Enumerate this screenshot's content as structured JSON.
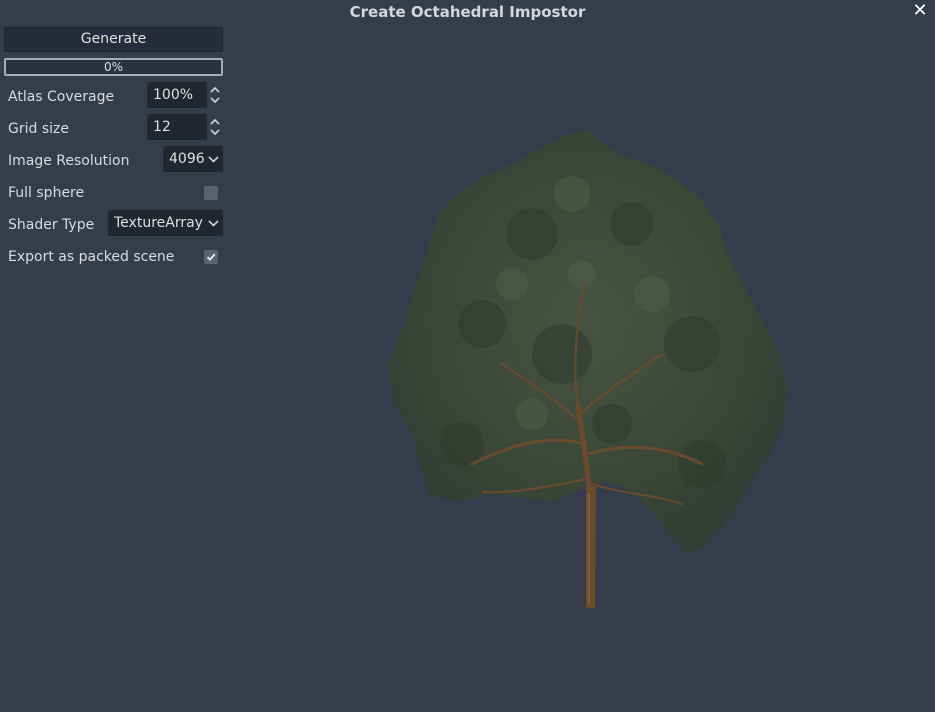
{
  "window": {
    "title": "Create Octahedral Impostor",
    "close_glyph": "✕"
  },
  "sidebar": {
    "generate_label": "Generate",
    "progress": {
      "value": 0,
      "text": "0%"
    },
    "atlas_coverage": {
      "label": "Atlas Coverage",
      "value": "100%"
    },
    "grid_size": {
      "label": "Grid size",
      "value": "12"
    },
    "image_resolution": {
      "label": "Image Resolution",
      "value": "4096"
    },
    "full_sphere": {
      "label": "Full sphere",
      "checked": false
    },
    "shader_type": {
      "label": "Shader Type",
      "value": "TextureArray"
    },
    "export_packed": {
      "label": "Export as packed scene",
      "checked": true
    }
  },
  "colors": {
    "background": "#363d4a",
    "field": "#21262f",
    "button": "#262c3b",
    "progress_border": "#a6abb4",
    "foliage": "#3a4a37",
    "trunk": "#6b4a2e"
  },
  "icons": {
    "close": "close-icon",
    "spin": "up-down-arrows-icon",
    "dropdown": "chevron-down-icon",
    "check": "checkmark-icon"
  },
  "viewport": {
    "subject": "tree-preview"
  }
}
